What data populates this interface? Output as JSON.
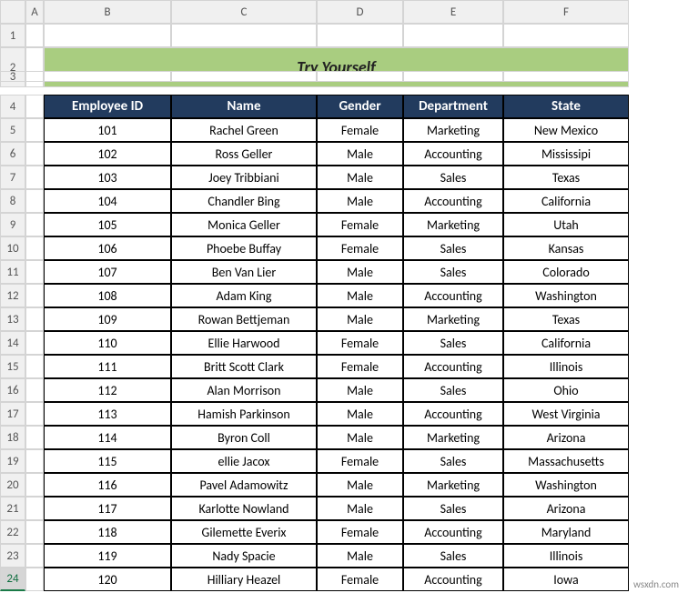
{
  "columns": [
    "A",
    "B",
    "C",
    "D",
    "E",
    "F"
  ],
  "title": "Try Yourself",
  "headers": [
    "Employee ID",
    "Name",
    "Gender",
    "Department",
    "State"
  ],
  "rows": [
    {
      "id": "101",
      "name": "Rachel Green",
      "gender": "Female",
      "dept": "Marketing",
      "state": "New Mexico"
    },
    {
      "id": "102",
      "name": "Ross Geller",
      "gender": "Male",
      "dept": "Accounting",
      "state": "Mississipi"
    },
    {
      "id": "103",
      "name": "Joey Tribbiani",
      "gender": "Male",
      "dept": "Sales",
      "state": "Texas"
    },
    {
      "id": "104",
      "name": "Chandler Bing",
      "gender": "Male",
      "dept": "Accounting",
      "state": "California"
    },
    {
      "id": "105",
      "name": "Monica Geller",
      "gender": "Female",
      "dept": "Marketing",
      "state": "Utah"
    },
    {
      "id": "106",
      "name": "Phoebe Buffay",
      "gender": "Female",
      "dept": "Sales",
      "state": "Kansas"
    },
    {
      "id": "107",
      "name": "Ben Van Lier",
      "gender": "Male",
      "dept": "Sales",
      "state": "Colorado"
    },
    {
      "id": "108",
      "name": "Adam King",
      "gender": "Male",
      "dept": "Accounting",
      "state": "Washington"
    },
    {
      "id": "109",
      "name": "Rowan Bettjeman",
      "gender": "Male",
      "dept": "Marketing",
      "state": "Texas"
    },
    {
      "id": "110",
      "name": "Ellie Harwood",
      "gender": "Female",
      "dept": "Sales",
      "state": "California"
    },
    {
      "id": "111",
      "name": "Britt Scott Clark",
      "gender": "Female",
      "dept": "Accounting",
      "state": "Illinois"
    },
    {
      "id": "112",
      "name": "Alan Morrison",
      "gender": "Male",
      "dept": "Sales",
      "state": "Ohio"
    },
    {
      "id": "113",
      "name": "Hamish Parkinson",
      "gender": "Male",
      "dept": "Accounting",
      "state": "West Virginia"
    },
    {
      "id": "114",
      "name": "Byron Coll",
      "gender": "Male",
      "dept": "Marketing",
      "state": "Arizona"
    },
    {
      "id": "115",
      "name": "ellie Jacox",
      "gender": "Female",
      "dept": "Sales",
      "state": "Massachusetts"
    },
    {
      "id": "116",
      "name": "Pavel Adamowitz",
      "gender": "Male",
      "dept": "Marketing",
      "state": "Washington"
    },
    {
      "id": "117",
      "name": "Karlotte Nowland",
      "gender": "Male",
      "dept": "Sales",
      "state": "Arizona"
    },
    {
      "id": "118",
      "name": "Gilemette Everix",
      "gender": "Female",
      "dept": "Accounting",
      "state": "Maryland"
    },
    {
      "id": "119",
      "name": "Nady Spacie",
      "gender": "Male",
      "dept": "Sales",
      "state": "Illinois"
    },
    {
      "id": "120",
      "name": "Hilliary Heazel",
      "gender": "Female",
      "dept": "Accounting",
      "state": "Iowa"
    }
  ],
  "row_labels": [
    "1",
    "2",
    "3",
    "4",
    "5",
    "6",
    "7",
    "8",
    "9",
    "10",
    "11",
    "12",
    "13",
    "14",
    "15",
    "16",
    "17",
    "18",
    "19",
    "20",
    "21",
    "22",
    "23",
    "24"
  ],
  "active_row": "24",
  "watermark": "wsxdn.com"
}
